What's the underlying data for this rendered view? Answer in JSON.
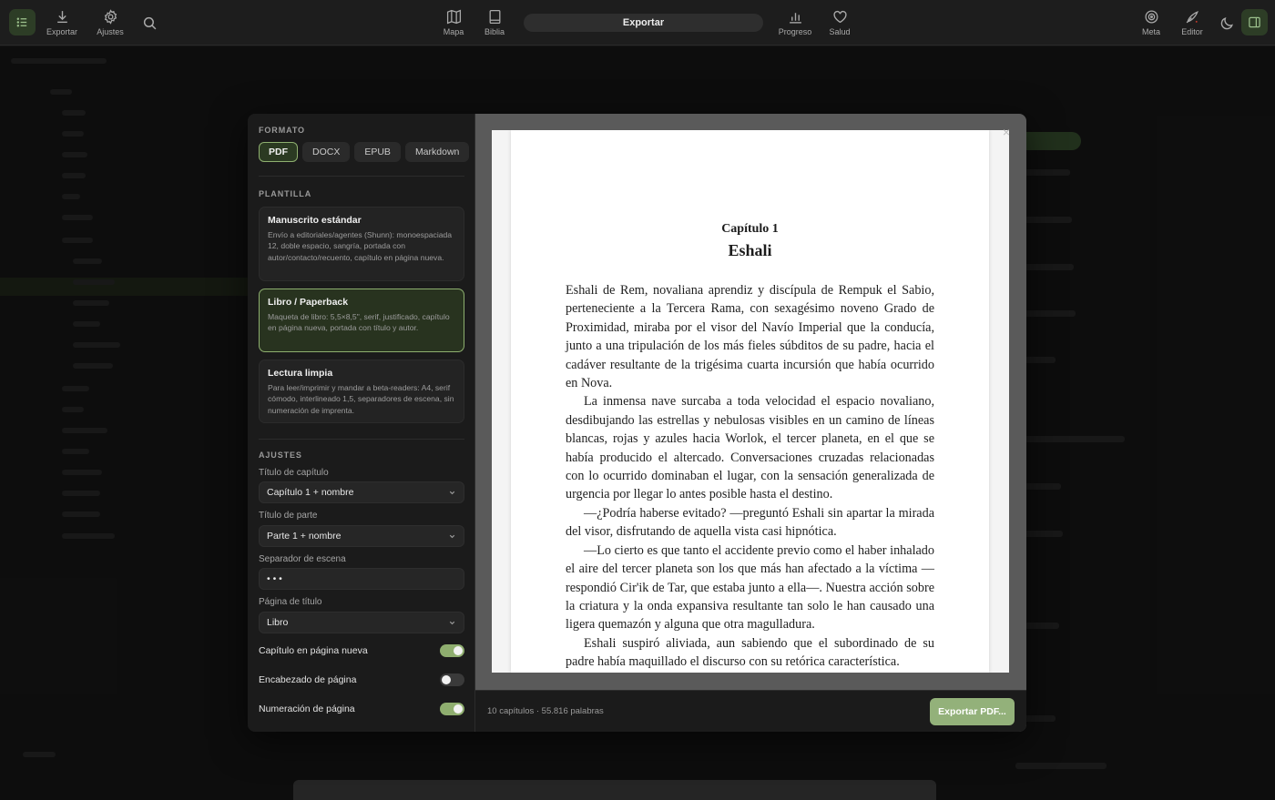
{
  "toolbar": {
    "export_label": "Exportar",
    "settings_label": "Ajustes",
    "map_label": "Mapa",
    "bible_label": "Biblia",
    "center_title": "Exportar",
    "progress_label": "Progreso",
    "health_label": "Salud",
    "goal_label": "Meta",
    "editor_label": "Editor"
  },
  "colors": {
    "accent": "#8fae6f",
    "accent_button": "#93b17a",
    "panel": "#1b1b1b",
    "preview_bg": "#5a5a5a"
  },
  "format": {
    "heading": "FORMATO",
    "tabs": [
      "PDF",
      "DOCX",
      "EPUB",
      "Markdown"
    ],
    "selected": "PDF"
  },
  "template": {
    "heading": "PLANTILLA",
    "items": [
      {
        "title": "Manuscrito estándar",
        "desc": "Envío a editoriales/agentes (Shunn): monoespaciada 12, doble espacio, sangría, portada con autor/contacto/recuento, capítulo en página nueva."
      },
      {
        "title": "Libro / Paperback",
        "desc": "Maqueta de libro: 5,5×8,5\", serif, justificado, capítulo en página nueva, portada con título y autor."
      },
      {
        "title": "Lectura limpia",
        "desc": "Para leer/imprimir y mandar a beta-readers: A4, serif cómodo, interlineado 1,5, separadores de escena, sin numeración de imprenta."
      }
    ],
    "selected": "Libro / Paperback"
  },
  "settings": {
    "heading": "AJUSTES",
    "chapter_title_label": "Título de capítulo",
    "chapter_title_value": "Capítulo 1 + nombre",
    "part_title_label": "Título de parte",
    "part_title_value": "Parte 1 + nombre",
    "scene_sep_label": "Separador de escena",
    "scene_sep_value": "• • •",
    "title_page_label": "Página de título",
    "title_page_value": "Libro",
    "toggles": [
      {
        "label": "Capítulo en página nueva",
        "on": true
      },
      {
        "label": "Encabezado de página",
        "on": false
      },
      {
        "label": "Numeración de página",
        "on": true
      }
    ]
  },
  "preview": {
    "chapter_number": "Capítulo 1",
    "chapter_name": "Eshali",
    "paragraphs": [
      "Eshali de Rem, novaliana aprendiz y discípula de Rempuk el Sabio, perteneciente a la Tercera Rama, con sexagésimo noveno Grado de Proximidad, miraba por el visor del Navío Imperial que la conducía, junto a una tripulación de los más fieles súbditos de su padre, hacia el cadáver resultante de la trigésima cuarta incursión que había ocurrido en Nova.",
      "La inmensa nave surcaba a toda velocidad el espacio novaliano, desdibujando las estrellas y nebulosas visibles en un camino de líneas blancas, rojas y azules hacia Worlok, el tercer planeta, en el que se había producido el altercado. Conversaciones cruzadas relacionadas con lo ocurrido dominaban el lugar, con la sensación generalizada de urgencia por llegar lo antes posible hasta el destino.",
      "—¿Podría haberse evitado? —preguntó Eshali sin apartar la mirada del visor, disfrutando de aquella vista casi hipnótica.",
      "—Lo cierto es que tanto el accidente previo como el haber inhalado el aire del tercer planeta son los que más han afectado a la víctima —respondió Cir'ik de Tar, que estaba junto a ella—. Nuestra acción sobre la criatura y la onda expansiva resultante tan solo le han causado una ligera quemazón y alguna que otra magulladura.",
      "Eshali suspiró aliviada, aun sabiendo que el subordinado de su padre había maquillado el discurso con su retórica característica."
    ]
  },
  "footer": {
    "stats": "10 capítulos · 55.816 palabras",
    "export_button": "Exportar PDF..."
  }
}
